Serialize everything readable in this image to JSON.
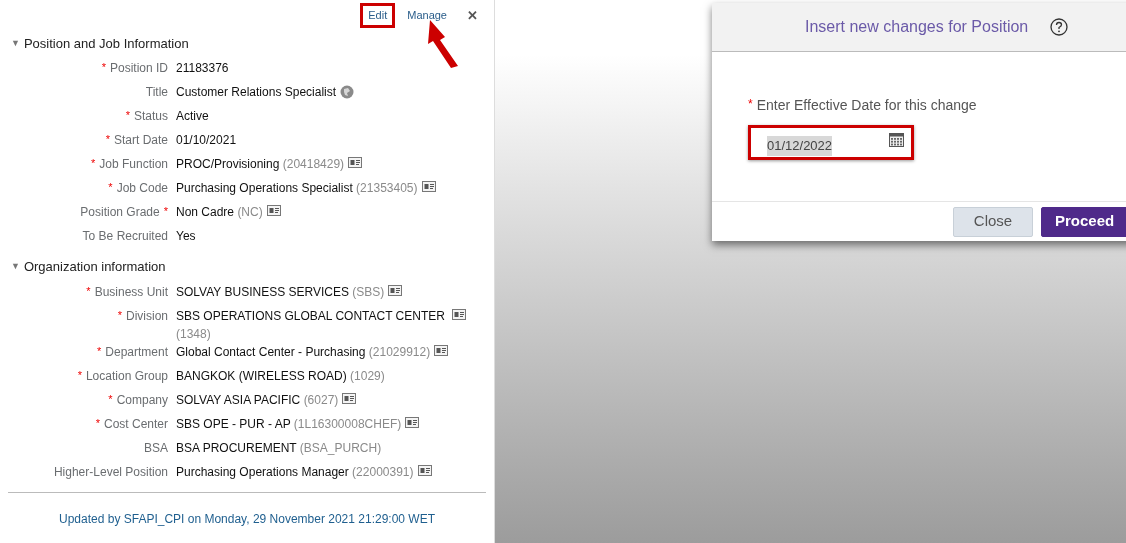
{
  "panel": {
    "links": [
      {
        "label": "Edit",
        "highlighted": true
      },
      {
        "label": "Manage",
        "highlighted": false
      }
    ],
    "close": "✕",
    "sections": [
      {
        "toggle": "▼",
        "title": "Position and Job Information",
        "expanded": true,
        "fields": [
          {
            "kind": "plain",
            "prefix": "*",
            "label": "Position ID",
            "value": "21183376"
          },
          {
            "kind": "globe",
            "label": "Title",
            "value": "Customer Relations Specialist"
          },
          {
            "kind": "plain",
            "prefix": "*",
            "label": "Status",
            "value": "Active"
          },
          {
            "kind": "plain",
            "prefix": "*",
            "label": "Start Date",
            "value": "01/10/2021"
          },
          {
            "kind": "card",
            "prefix": "*",
            "label": "Job Function",
            "value": "PROC/Provisioning",
            "code": "(20418429)"
          },
          {
            "kind": "card",
            "prefix": "*",
            "label": "Job Code",
            "value": "Purchasing Operations Specialist",
            "code": "(21353405)"
          },
          {
            "kind": "card",
            "label": "Position Grade",
            "suffix": "*",
            "value": "Non Cadre",
            "code": "(NC)"
          },
          {
            "kind": "plain",
            "label": "To Be Recruited",
            "value": "Yes"
          }
        ]
      },
      {
        "toggle": "▼",
        "title": "Organization information",
        "expanded": true,
        "fields": [
          {
            "kind": "card",
            "prefix": "*",
            "label": "Business Unit",
            "value": "SOLVAY BUSINESS SERVICES",
            "code": "(SBS)"
          },
          {
            "kind": "card",
            "prefix": "*",
            "label": "Division",
            "value": "SBS OPERATIONS GLOBAL CONTACT CENTER",
            "code": "(1348)"
          },
          {
            "kind": "card",
            "prefix": "*",
            "label": "Department",
            "value": "Global Contact Center - Purchasing",
            "code": "(21029912)"
          },
          {
            "kind": "plain",
            "prefix": "*",
            "label": "Location Group",
            "value": "BANGKOK (WIRELESS ROAD)",
            "code": "(1029)"
          },
          {
            "kind": "card",
            "prefix": "*",
            "label": "Company",
            "value": "SOLVAY ASIA PACIFIC",
            "code": "(6027)"
          },
          {
            "kind": "card",
            "prefix": "*",
            "label": "Cost Center",
            "value": "SBS OPE - PUR - AP",
            "code": "(1L16300008CHEF)"
          },
          {
            "kind": "plain",
            "label": "BSA",
            "value": "BSA PROCUREMENT",
            "code": "(BSA_PURCH)"
          },
          {
            "kind": "card",
            "label": "Higher-Level Position",
            "value": "Purchasing Operations Manager",
            "code": "(22000391)"
          }
        ]
      }
    ],
    "footer": "Updated by SFAPI_CPI on Monday, 29 November 2021 21:29:00 WET"
  },
  "dialog": {
    "title": "Insert new changes for Position",
    "field": {
      "prefix": "*",
      "label": "Enter Effective Date for this change",
      "value": "01/12/2022",
      "highlighted": true
    },
    "buttons": [
      {
        "label": "Close",
        "kind": "secondary"
      },
      {
        "label": "Proceed",
        "kind": "primary"
      }
    ]
  }
}
